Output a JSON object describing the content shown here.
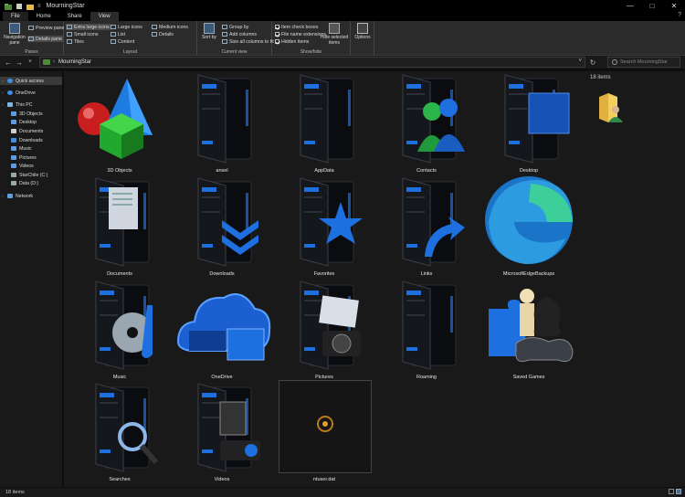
{
  "window": {
    "title": "MourningStar",
    "minimize": "—",
    "maximize": "□",
    "close": "✕"
  },
  "ribbon_tabs": [
    "File",
    "Home",
    "Share",
    "View"
  ],
  "ribbon": {
    "panes": {
      "label": "Panes",
      "navigation_pane": "Navigation pane",
      "preview_pane": "Preview pane",
      "details_pane": "Details pane"
    },
    "layout": {
      "label": "Layout",
      "extra_large_icons": "Extra large icons",
      "large_icons": "Large icons",
      "medium_icons": "Medium icons",
      "small_icons": "Small icons",
      "list": "List",
      "details": "Details",
      "tiles": "Tiles",
      "content": "Content"
    },
    "current_view": {
      "label": "Current view",
      "sort_by": "Sort by",
      "group_by": "Group by",
      "add_columns": "Add columns",
      "size_all_columns": "Size all columns to fit"
    },
    "show_hide": {
      "label": "Show/hide",
      "item_check_boxes": "Item check boxes",
      "file_name_extensions": "File name extensions",
      "hidden_items": "Hidden items",
      "hide_selected_items": "Hide selected items"
    },
    "options": "Options"
  },
  "address": {
    "path": "MourningStar",
    "search_placeholder": "Search MourningStar"
  },
  "nav_pane": [
    {
      "label": "Quick access",
      "icon": "star-icon",
      "level": 0,
      "selected": true,
      "color": "#3f8fe0"
    },
    {
      "label": "OneDrive",
      "icon": "cloud-icon",
      "level": 0,
      "selected": false,
      "color": "#3f8fe0"
    },
    {
      "label": "This PC",
      "icon": "computer-icon",
      "level": 0,
      "selected": false,
      "color": "#7fb2e5"
    },
    {
      "label": "3D Objects",
      "icon": "cube-icon",
      "level": 1,
      "selected": false,
      "color": "#5aa0e0"
    },
    {
      "label": "Desktop",
      "icon": "desktop-icon",
      "level": 1,
      "selected": false,
      "color": "#5aa0e0"
    },
    {
      "label": "Documents",
      "icon": "document-icon",
      "level": 1,
      "selected": false,
      "color": "#cfcfcf"
    },
    {
      "label": "Downloads",
      "icon": "download-icon",
      "level": 1,
      "selected": false,
      "color": "#3f8fe0"
    },
    {
      "label": "Music",
      "icon": "music-icon",
      "level": 1,
      "selected": false,
      "color": "#5aa0e0"
    },
    {
      "label": "Pictures",
      "icon": "pictures-icon",
      "level": 1,
      "selected": false,
      "color": "#5aa0e0"
    },
    {
      "label": "Videos",
      "icon": "video-icon",
      "level": 1,
      "selected": false,
      "color": "#5aa0e0"
    },
    {
      "label": "StarChile (C:)",
      "icon": "drive-icon",
      "level": 1,
      "selected": false,
      "color": "#9aa"
    },
    {
      "label": "Data (D:)",
      "icon": "drive-icon",
      "level": 1,
      "selected": false,
      "color": "#9aa"
    },
    {
      "label": "Network",
      "icon": "network-icon",
      "level": 0,
      "selected": false,
      "color": "#5aa0e0"
    }
  ],
  "files": [
    {
      "name": "3D Objects",
      "icon": "3d-objects-icon"
    },
    {
      "name": "ansel",
      "icon": "dark-folder-icon"
    },
    {
      "name": "AppData",
      "icon": "dark-folder-icon"
    },
    {
      "name": "Contacts",
      "icon": "contacts-folder-icon"
    },
    {
      "name": "Desktop",
      "icon": "desktop-folder-icon"
    },
    {
      "name": "Documents",
      "icon": "documents-folder-icon"
    },
    {
      "name": "Downloads",
      "icon": "downloads-folder-icon"
    },
    {
      "name": "Favorites",
      "icon": "favorites-folder-icon"
    },
    {
      "name": "Links",
      "icon": "links-folder-icon"
    },
    {
      "name": "MicrosoftEdgeBackups",
      "icon": "edge-icon"
    },
    {
      "name": "Music",
      "icon": "music-folder-icon"
    },
    {
      "name": "OneDrive",
      "icon": "onedrive-folder-icon"
    },
    {
      "name": "Pictures",
      "icon": "pictures-folder-icon"
    },
    {
      "name": "Roaming",
      "icon": "dark-folder-icon"
    },
    {
      "name": "Saved Games",
      "icon": "saved-games-icon"
    },
    {
      "name": "Searches",
      "icon": "searches-folder-icon"
    },
    {
      "name": "Videos",
      "icon": "videos-folder-icon"
    },
    {
      "name": "ntuser.dat",
      "icon": "dat-file-icon"
    }
  ],
  "details": {
    "items_count": "18 items"
  },
  "status": {
    "items_count": "18 items"
  },
  "colors": {
    "accent_blue": "#1e6fe0",
    "folder_dark": "#1a1d22",
    "edge_green": "#3ccf9a"
  }
}
